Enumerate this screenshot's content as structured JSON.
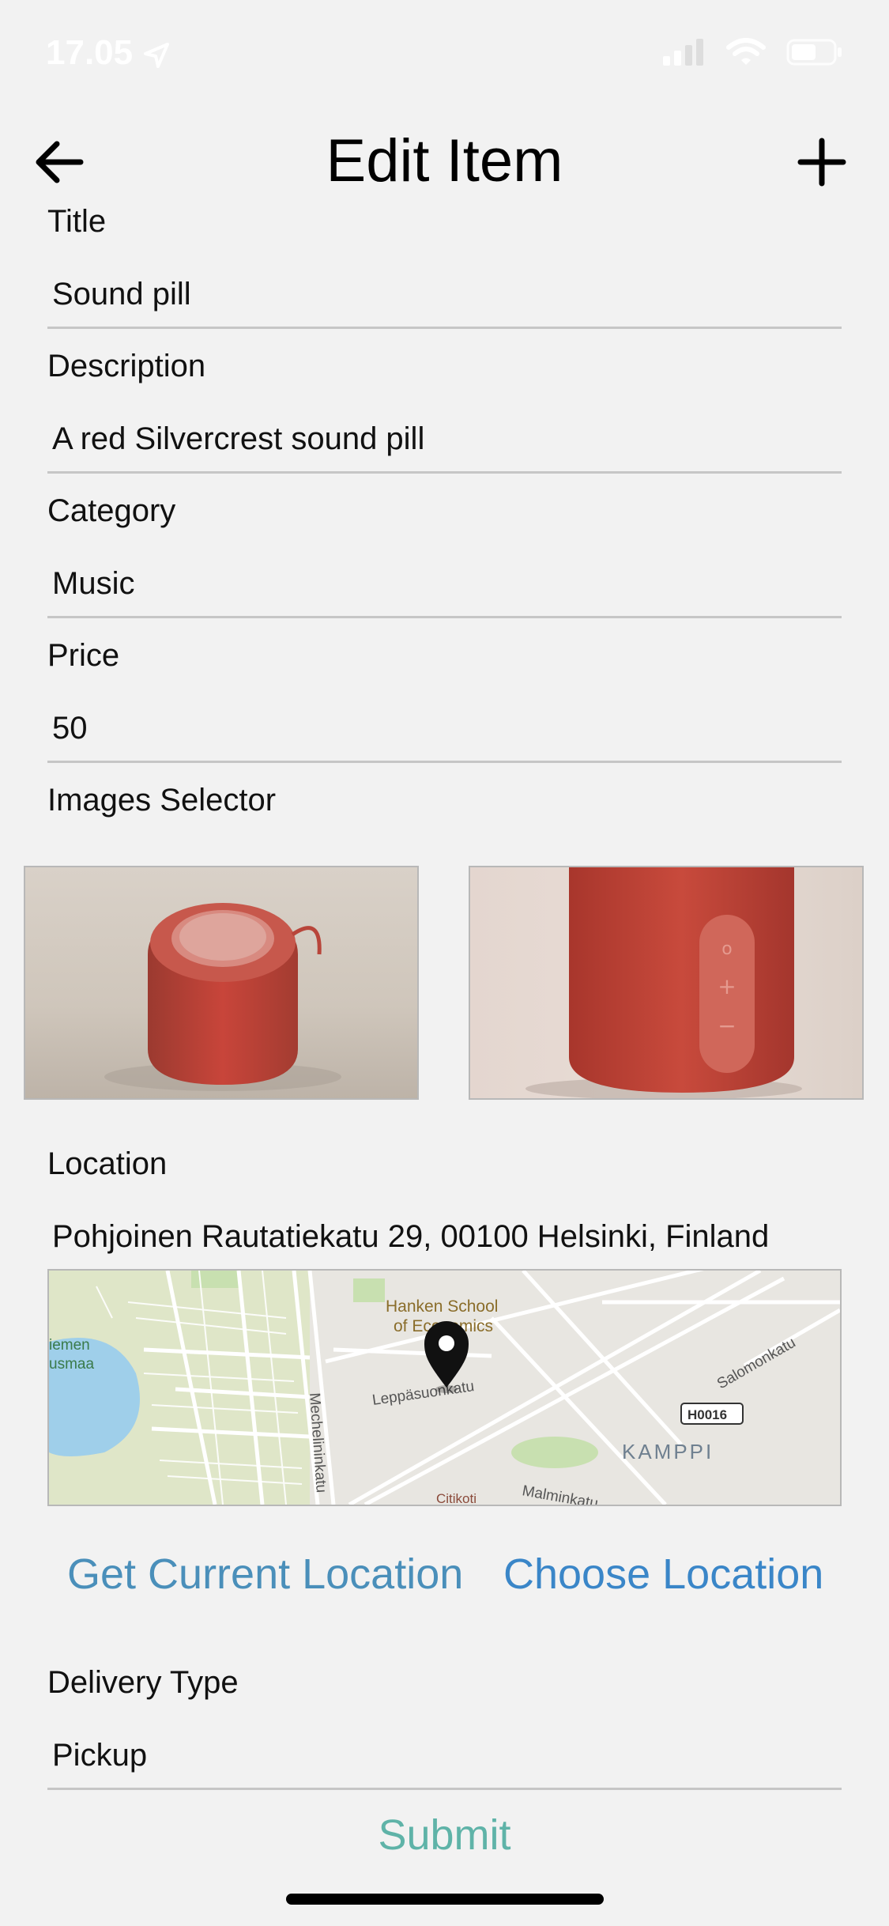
{
  "status_bar": {
    "time": "17.05",
    "icons": [
      "location-arrow-icon",
      "signal-icon",
      "wifi-icon",
      "battery-icon"
    ]
  },
  "header": {
    "title": "Edit Item",
    "back_icon": "arrow-left-icon",
    "add_icon": "plus-icon"
  },
  "fields": {
    "title": {
      "label": "Title",
      "value": "Sound pill"
    },
    "description": {
      "label": "Description",
      "value": "A red Silvercrest sound pill"
    },
    "category": {
      "label": "Category",
      "value": "Music"
    },
    "price": {
      "label": "Price",
      "value": "50"
    }
  },
  "images_selector": {
    "label": "Images Selector",
    "images": [
      "red-speaker-top-view",
      "red-speaker-side-view"
    ]
  },
  "location": {
    "label": "Location",
    "address": "Pohjoinen Rautatiekatu 29, 00100 Helsinki, Finland",
    "map_labels": {
      "hanken": "Hanken School",
      "hanken2": "of Economics",
      "leppasuonkatu": "Leppäsuonkatu",
      "salomonkatu": "Salomonkatu",
      "mechelininkatu": "Mechelininkatu",
      "kamppi": "KAMPPI",
      "bus_stop": "H0016",
      "malminkatu": "Malminkatu",
      "citikoti": "Citikoti",
      "lapinlahti": "iemen",
      "lapinlahti2": "usmaa"
    }
  },
  "actions": {
    "get_current_location": "Get Current Location",
    "choose_location": "Choose Location"
  },
  "delivery": {
    "label": "Delivery Type",
    "value": "Pickup"
  },
  "submit_label": "Submit",
  "colors": {
    "background": "#f2f2f2",
    "link": "#3a86c8",
    "submit": "#5fb3a8",
    "speaker_red": "#c8453a"
  }
}
